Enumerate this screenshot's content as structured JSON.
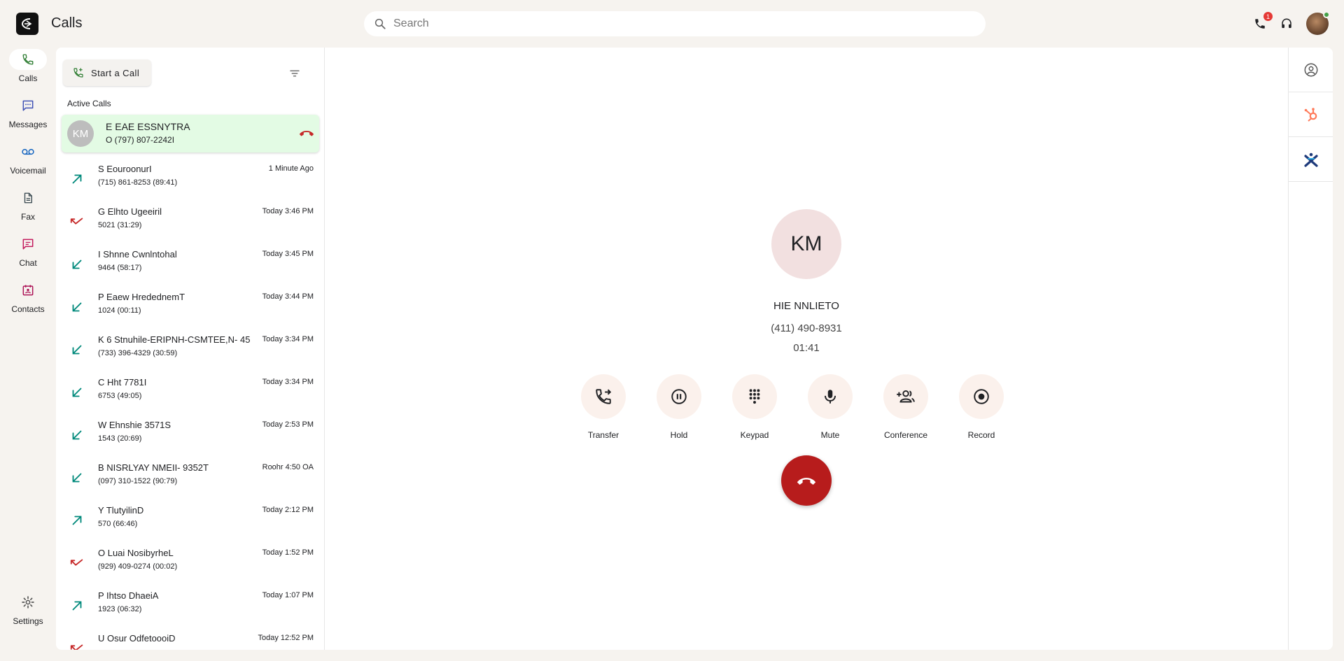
{
  "app": {
    "title": "Calls"
  },
  "search": {
    "placeholder": "Search"
  },
  "topbar": {
    "notification_count": "1"
  },
  "nav": {
    "items": [
      {
        "label": "Calls"
      },
      {
        "label": "Messages"
      },
      {
        "label": "Voicemail"
      },
      {
        "label": "Fax"
      },
      {
        "label": "Chat"
      },
      {
        "label": "Contacts"
      }
    ],
    "settings_label": "Settings"
  },
  "call_list": {
    "start_call_label": "Start a Call",
    "active_section_label": "Active Calls",
    "active_call": {
      "initials": "KM",
      "name": "E EAE ESSNYTRA",
      "number": "O (797) 807-2242I"
    },
    "history": [
      {
        "direction": "outgoing",
        "name": "S EouroonurI",
        "number": "(715) 861-8253 (89:41)",
        "time": "1 Minute Ago"
      },
      {
        "direction": "missed",
        "name": "G Elhto Ugeeiril",
        "number": "5021 (31:29)",
        "time": "Today 3:46 PM"
      },
      {
        "direction": "incoming",
        "name": "I Shnne Cwnlntohal",
        "number": "9464 (58:17)",
        "time": "Today 3:45 PM"
      },
      {
        "direction": "incoming",
        "name": "P Eaew HredednemT",
        "number": "1024 (00:11)",
        "time": "Today 3:44 PM"
      },
      {
        "direction": "incoming",
        "name": "K 6 Stnuhile-ERIPNH-CSMTEE,N- 45",
        "number": "(733) 396-4329 (30:59)",
        "time": "Today 3:34 PM"
      },
      {
        "direction": "incoming",
        "name": "C Hht 7781I",
        "number": "6753 (49:05)",
        "time": "Today 3:34 PM"
      },
      {
        "direction": "incoming",
        "name": "W Ehnshie 3571S",
        "number": "1543 (20:69)",
        "time": "Today 2:53 PM"
      },
      {
        "direction": "incoming",
        "name": "B NISRLYAY NMEII- 9352T",
        "number": "(097) 310-1522 (90:79)",
        "time": "Roohr 4:50 OA"
      },
      {
        "direction": "outgoing",
        "name": "Y TlutyilinD",
        "number": "570 (66:46)",
        "time": "Today 2:12 PM"
      },
      {
        "direction": "missed",
        "name": "O Luai NosibyrheL",
        "number": "(929) 409-0274 (00:02)",
        "time": "Today 1:52 PM"
      },
      {
        "direction": "outgoing",
        "name": "P Ihtso DhaeiA",
        "number": "1923 (06:32)",
        "time": "Today 1:07 PM"
      },
      {
        "direction": "missed",
        "name": "U Osur OdfetoooiD",
        "number": "",
        "time": "Today 12:52 PM"
      }
    ]
  },
  "current_call": {
    "initials": "KM",
    "name": "HIE NNLIETO",
    "number": "(411) 490-8931",
    "timer": "01:41",
    "controls": [
      "Transfer",
      "Hold",
      "Keypad",
      "Mute",
      "Conference",
      "Record"
    ]
  },
  "colors": {
    "accent_green": "#2e7d32",
    "teal": "#00897b",
    "missed_red": "#c62828",
    "hangup_red": "#b71c1c",
    "chat_pink": "#c2185b",
    "hubspot_orange": "#ff7a59"
  }
}
